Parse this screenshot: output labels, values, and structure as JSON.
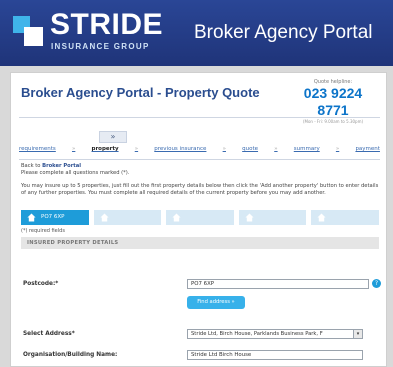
{
  "banner": {
    "logo_text": "STRIDE",
    "logo_sub": "INSURANCE GROUP",
    "title": "Broker Agency Portal"
  },
  "page": {
    "title": "Broker Agency Portal - Property Quote",
    "helpline_label": "Quote helpline:",
    "helpline_number": "023 9224 8771",
    "helpline_hours": "(Mon - Fri: 9.00am to 5.30pm)"
  },
  "steps": {
    "arrow": "»",
    "items": [
      "requirements",
      "property",
      "previous insurance",
      "quote",
      "summary",
      "payment"
    ],
    "active_index": 1,
    "separator": "»"
  },
  "intro": {
    "back_prefix": "Back to ",
    "back_link": "Broker Portal",
    "required_notice": "Please complete all questions marked (*).",
    "paragraph": "You may insure up to 5 properties, just fill out the first property details below then click the 'Add another property' button to enter details of any further properties. You must complete all required details of the current property before you may add another."
  },
  "property_tabs": [
    {
      "label": "PO7 6XP",
      "active": true
    },
    {
      "label": "",
      "active": false
    },
    {
      "label": "",
      "active": false
    },
    {
      "label": "",
      "active": false
    },
    {
      "label": "",
      "active": false
    }
  ],
  "form": {
    "required_fields_note": "(*) required fields",
    "section_title": "INSURED PROPERTY DETAILS",
    "postcode_label": "Postcode:*",
    "postcode_value": "PO7 6XP",
    "find_address_label": "Find address »",
    "select_address_label": "Select Address*",
    "select_address_value": "Stride Ltd, Birch House, Parklands Business Park, F",
    "organisation_label": "Organisation/Building Name:",
    "organisation_value": "Stride Ltd Birch House"
  },
  "colors": {
    "banner_bg": "#233b86",
    "accent": "#1e9cd9",
    "title": "#2a4d8f",
    "helpline": "#0c74c9"
  }
}
